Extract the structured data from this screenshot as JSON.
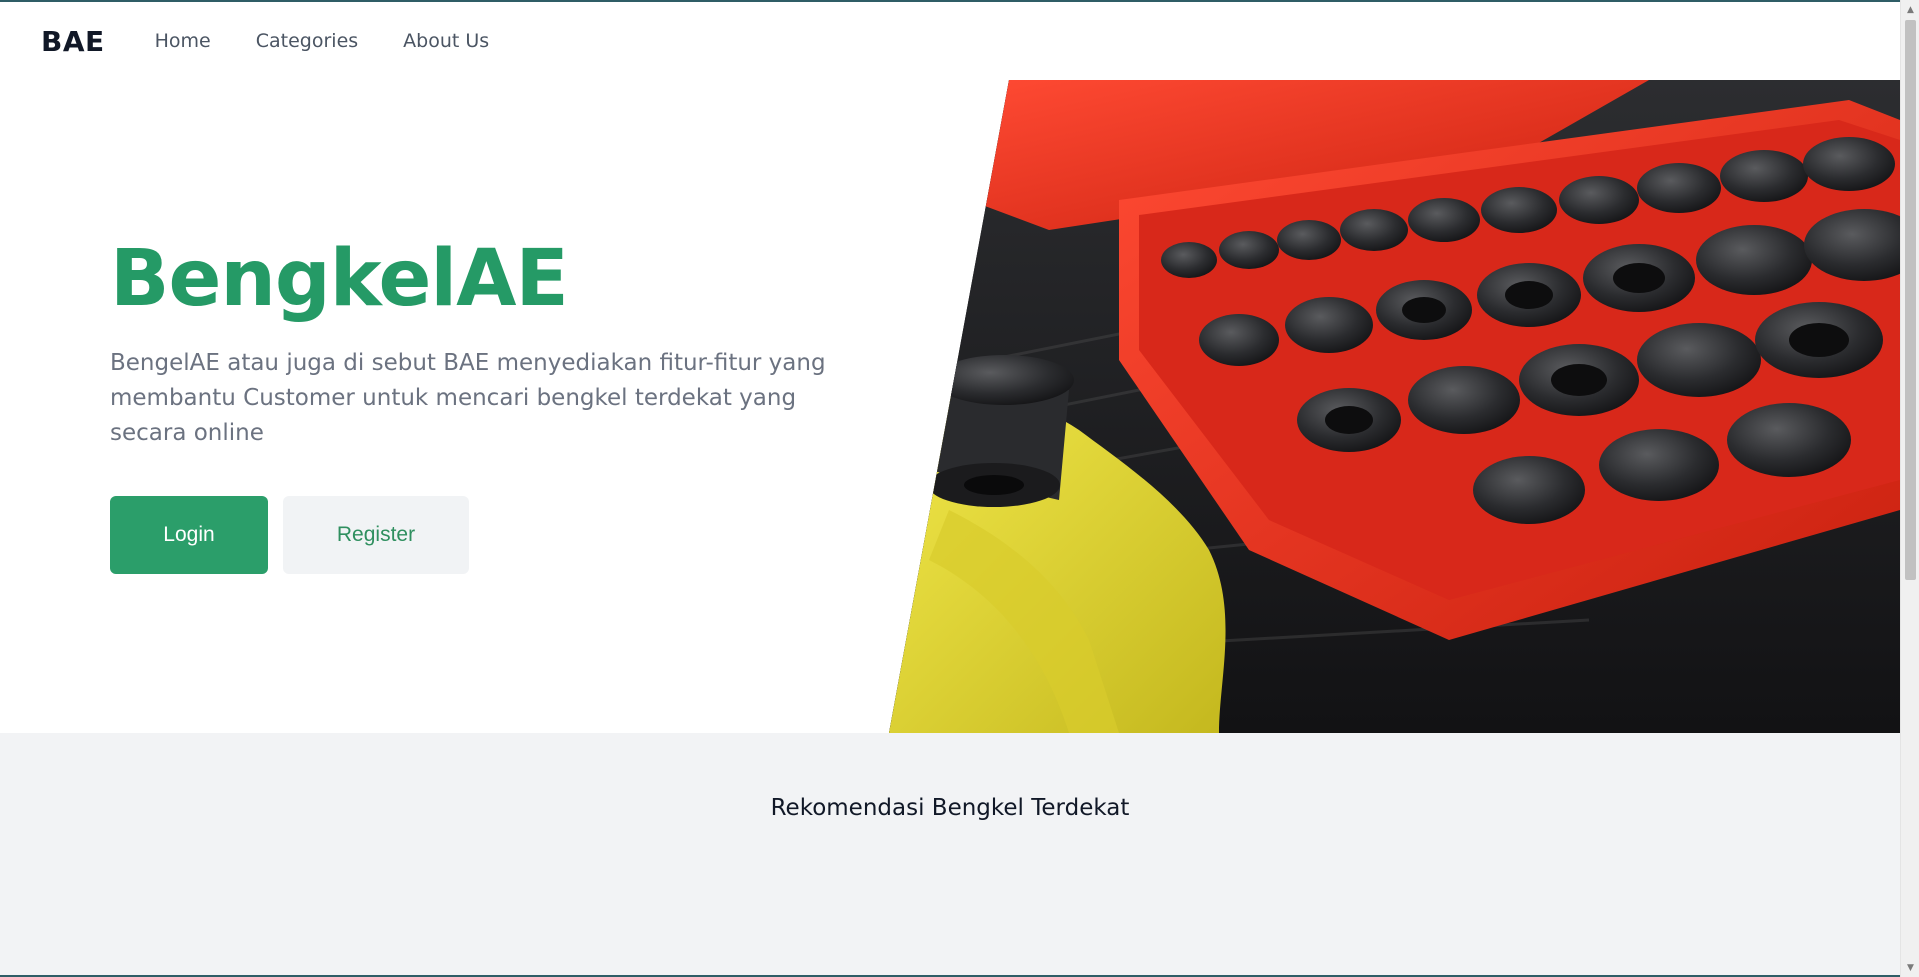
{
  "navbar": {
    "brand": "BAE",
    "links": [
      "Home",
      "Categories",
      "About Us"
    ]
  },
  "hero": {
    "title": "BengkelAE",
    "description": "BengelAE atau juga di sebut BAE menyediakan fitur-fitur yang membantu Customer untuk mencari bengkel terdekat yang secara online",
    "login_label": "Login",
    "register_label": "Register"
  },
  "recommendation": {
    "title": "Rekomendasi Bengkel Terdekat"
  },
  "colors": {
    "accent_green": "#259a66",
    "button_green": "#2b9e6a",
    "section_gray": "#f2f3f5"
  }
}
